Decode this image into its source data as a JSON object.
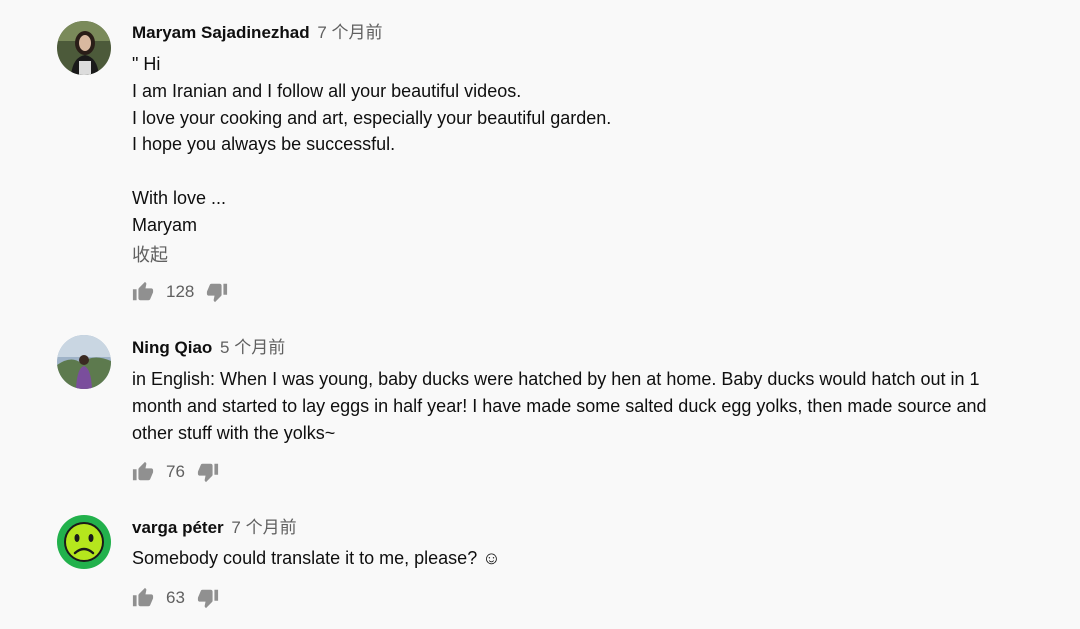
{
  "comments": [
    {
      "author": "Maryam Sajadinezhad",
      "time": "7 个月前",
      "lines": [
        "\" Hi",
        "I am Iranian and I follow all your beautiful videos.",
        "I love your cooking and art, especially your beautiful garden.",
        "I hope you always be successful.",
        "",
        "With love ...",
        "Maryam"
      ],
      "collapse_label": "收起",
      "likes": "128",
      "avatar_icon": "woman-portrait-avatar"
    },
    {
      "author": "Ning Qiao",
      "time": "5 个月前",
      "text": "in English: When I was young, baby ducks were hatched by hen at home. Baby ducks would hatch out in 1 month and started to lay eggs in half year! I have made some salted duck egg yolks, then made source and other stuff with the yolks~",
      "likes": "76",
      "avatar_icon": "person-outdoor-avatar"
    },
    {
      "author": "varga péter",
      "time": "7 个月前",
      "text": "Somebody could translate it to me, please? ☺",
      "likes": "63",
      "avatar_icon": "sad-face-avatar"
    }
  ],
  "icons": {
    "like": "thumb-up-icon",
    "dislike": "thumb-down-icon"
  },
  "colors": {
    "background": "#f9f9f9",
    "text": "#0f0f0f",
    "secondary": "#606060",
    "sad_face_green": "#22b14c"
  }
}
